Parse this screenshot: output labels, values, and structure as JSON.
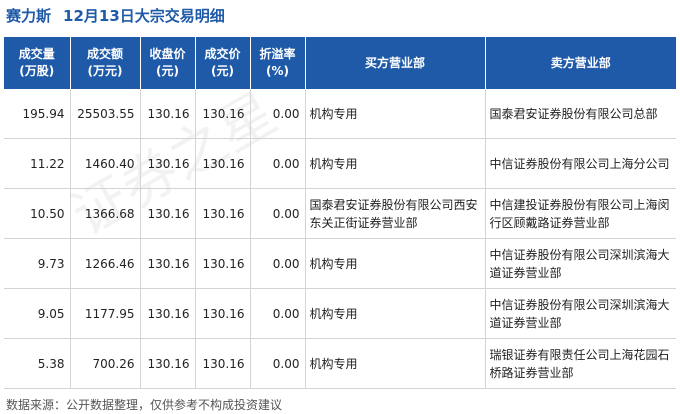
{
  "header": {
    "stock_name": "赛力斯",
    "title": "12月13日大宗交易明细"
  },
  "table": {
    "columns": [
      [
        "成交量",
        "(万股)"
      ],
      [
        "成交额",
        "(万元)"
      ],
      [
        "收盘价",
        "(元)"
      ],
      [
        "成交价",
        "(元)"
      ],
      [
        "折溢率",
        "(%)"
      ],
      [
        "买方营业部",
        ""
      ],
      [
        "卖方营业部",
        ""
      ]
    ],
    "rows": [
      [
        "195.94",
        "25503.55",
        "130.16",
        "130.16",
        "0.00",
        "机构专用",
        "国泰君安证券股份有限公司总部"
      ],
      [
        "11.22",
        "1460.40",
        "130.16",
        "130.16",
        "0.00",
        "机构专用",
        "中信证券股份有限公司上海分公司"
      ],
      [
        "10.50",
        "1366.68",
        "130.16",
        "130.16",
        "0.00",
        "国泰君安证券股份有限公司西安东关正街证券营业部",
        "中信建投证券股份有限公司上海闵行区顾戴路证券营业部"
      ],
      [
        "9.73",
        "1266.46",
        "130.16",
        "130.16",
        "0.00",
        "机构专用",
        "中信证券股份有限公司深圳滨海大道证券营业部"
      ],
      [
        "9.05",
        "1177.95",
        "130.16",
        "130.16",
        "0.00",
        "机构专用",
        "中信证券股份有限公司深圳滨海大道证券营业部"
      ],
      [
        "5.38",
        "700.26",
        "130.16",
        "130.16",
        "0.00",
        "机构专用",
        "瑞银证券有限责任公司上海花园石桥路证券营业部"
      ]
    ]
  },
  "watermark": "证券之星",
  "footer": {
    "source": "数据来源：公开数据整理，仅供参考不构成投资建议"
  }
}
